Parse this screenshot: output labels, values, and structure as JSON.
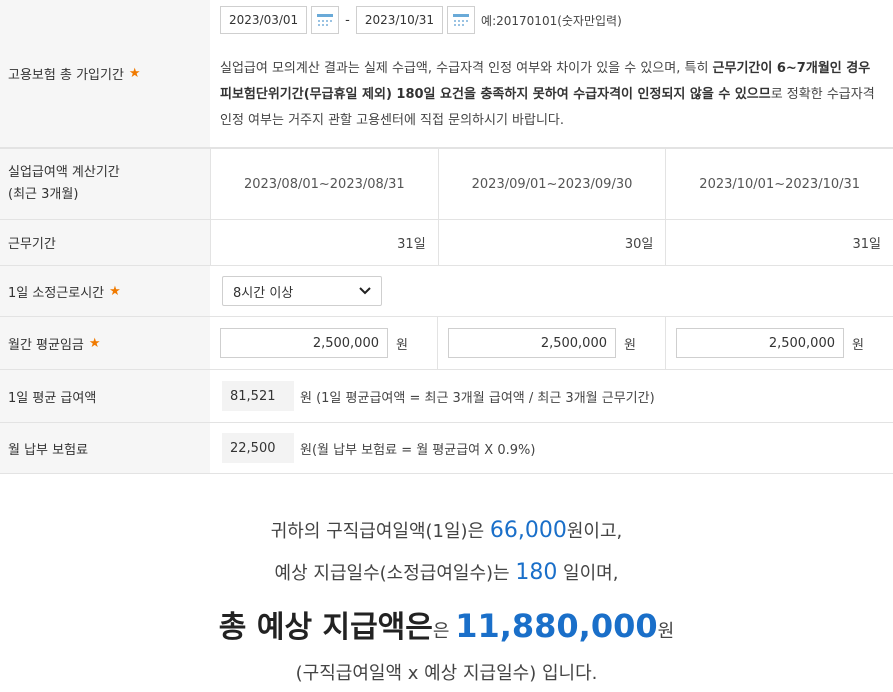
{
  "insurance_period": {
    "label": "고용보험 총 가입기간",
    "required_mark": "★",
    "start_date": "2023/03/01",
    "separator": "-",
    "end_date": "2023/10/31",
    "example": "예:20170101(숫자만입력)",
    "notice_part1": "실업급여 모의계산 결과는 실제 수급액, 수급자격 인정 여부와 차이가 있을 수 있으며, 특히 ",
    "notice_bold": "근무기간이 6~7개월인 경우 피보험단위기간(무급휴일 제외) 180일 요건을 충족하지 못하여 수급자격이 인정되지 않을 수 있으므",
    "notice_part2": "로 정확한 수급자격 인정 여부는 거주지 관할 고용센터에 직접 문의하시기 바랍니다."
  },
  "calc_period": {
    "label_line1": "실업급여액 계산기간",
    "label_line2": "(최근 3개월)",
    "periods": [
      "2023/08/01~2023/08/31",
      "2023/09/01~2023/09/30",
      "2023/10/01~2023/10/31"
    ]
  },
  "work_days": {
    "label": "근무기간",
    "values": [
      "31일",
      "30일",
      "31일"
    ]
  },
  "daily_hours": {
    "label": "1일 소정근로시간",
    "required_mark": "★",
    "selected": "8시간 이상"
  },
  "monthly_wage": {
    "label": "월간 평균임금",
    "required_mark": "★",
    "values": [
      "2,500,000",
      "2,500,000",
      "2,500,000"
    ],
    "unit": "원"
  },
  "daily_avg": {
    "label": "1일 평균 급여액",
    "value": "81,521",
    "desc": "원 (1일 평균급여액 = 최근 3개월 급여액 / 최근 3개월 근무기간)"
  },
  "monthly_premium": {
    "label": "월 납부 보험료",
    "value": "22,500",
    "desc": "원(월 납부 보험료 = 월 평균급여 X 0.9%)"
  },
  "result": {
    "line1_pre": "귀하의 구직급여일액(1일)은 ",
    "line1_amount": "66,000",
    "line1_post": "원이고,",
    "line2_pre": "예상 지급일수(소정급여일수)는 ",
    "line2_days": "180",
    "line2_post": " 일이며,",
    "line3_bold": "총 예상 지급액은",
    "line3_small": "은 ",
    "line3_amount": "11,880,000",
    "line3_unit": "원",
    "line4": "(구직급여일액 x 예상 지급일수) 입니다."
  },
  "colors": {
    "accent": "#1a6fc9",
    "required": "#f07a00",
    "label_bg": "#f6f6f6"
  },
  "icons": {
    "calendar": "calendar-icon",
    "select": "chevron-down-icon"
  }
}
